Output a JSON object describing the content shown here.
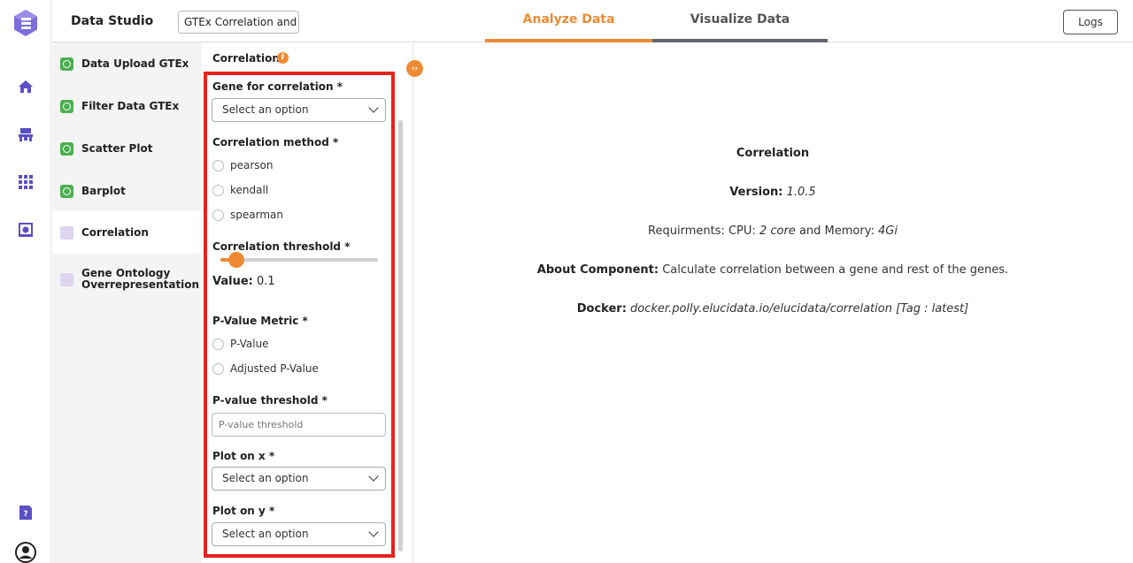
{
  "header": {
    "brand": "Data Studio",
    "project_name": "GTEx Correlation and",
    "tabs": [
      "Analyze Data",
      "Visualize Data"
    ],
    "logs_label": "Logs"
  },
  "rail": {
    "icons": [
      "logo-icon",
      "home-icon",
      "workspace-icon",
      "apps-grid-icon",
      "dataset-icon",
      "help-doc-icon",
      "user-icon"
    ]
  },
  "steps": [
    {
      "label": "Data Upload GTEx",
      "done": true
    },
    {
      "label": "Filter Data GTEx",
      "done": true
    },
    {
      "label": "Scatter Plot",
      "done": true
    },
    {
      "label": "Barplot",
      "done": true
    },
    {
      "label": "Correlation",
      "done": false
    },
    {
      "label": "Gene Ontology Overrepresentation",
      "done": false
    }
  ],
  "form": {
    "title": "Correlation",
    "gene_label": "Gene for correlation *",
    "gene_value": "Select an option",
    "method_label": "Correlation method *",
    "methods": [
      "pearson",
      "kendall",
      "spearman"
    ],
    "threshold_label": "Correlation threshold *",
    "threshold_value": 0.1,
    "value_prefix": "Value:",
    "value_text": "0.1",
    "pmetric_label": "P-Value Metric *",
    "pmetrics": [
      "P-Value",
      "Adjusted P-Value"
    ],
    "pthreshold_label": "P-value threshold *",
    "pthreshold_placeholder": "P-value threshold",
    "plotx_label": "Plot on x *",
    "plotx_value": "Select an option",
    "ploty_label": "Plot on y *",
    "ploty_value": "Select an option"
  },
  "component_info": {
    "name": "Correlation",
    "version_label": "Version:",
    "version": "1.0.5",
    "req_prefix": "Requirments: CPU:",
    "cpu": "2 core",
    "mem_prefix": "and Memory:",
    "memory": "4Gi",
    "about_label": "About Component:",
    "about": "Calculate correlation between a gene and rest of the genes.",
    "docker_label": "Docker:",
    "docker": "docker.polly.elucidata.io/elucidata/correlation [Tag : latest]"
  },
  "colors": {
    "accent": "#ee8a34",
    "highlight": "#e8221c",
    "done": "#4caf50",
    "brand": "#6b5bd6"
  }
}
